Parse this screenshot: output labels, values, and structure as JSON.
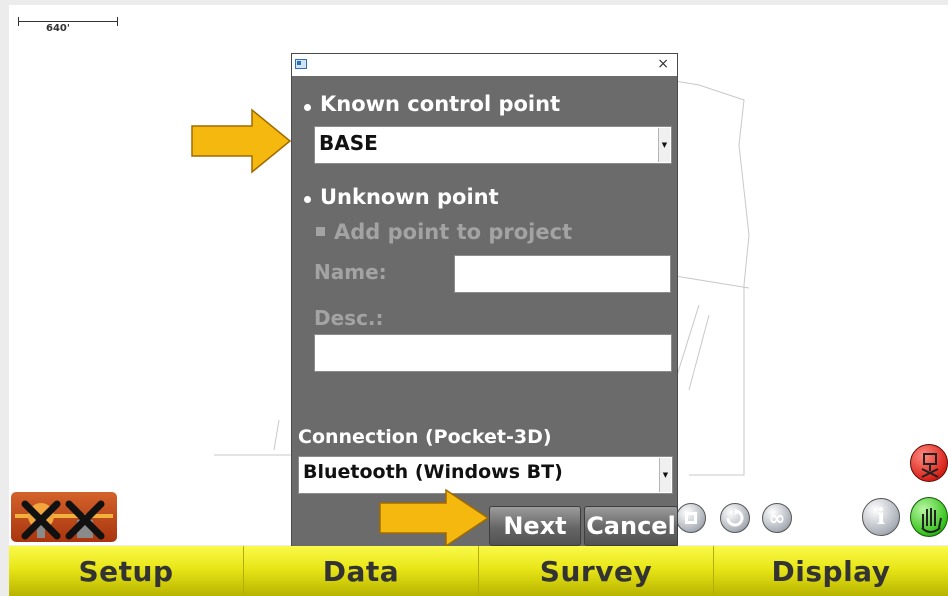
{
  "scale_bar": {
    "label": "640'"
  },
  "dialog": {
    "close_glyph": "×",
    "known_point_label": "Known control point",
    "known_point_value": "BASE",
    "unknown_point_label": "Unknown point",
    "add_point_label": "Add point to project",
    "name_label": "Name:",
    "name_value": "",
    "desc_label": "Desc.:",
    "desc_value": "",
    "connection_label": "Connection (Pocket-3D)",
    "connection_value": "Bluetooth (Windows BT)",
    "combo_arrow_glyph": "▼",
    "next_label": "Next",
    "cancel_label": "Cancel"
  },
  "toolbar": {
    "items": [
      {
        "label": "Setup"
      },
      {
        "label": "Data"
      },
      {
        "label": "Survey"
      },
      {
        "label": "Display"
      }
    ]
  },
  "icons": {
    "info_glyph": "i",
    "loop_glyph": "∞",
    "accent_arrow_color": "#f5b80f",
    "toolbar_color": "#e8e617"
  }
}
